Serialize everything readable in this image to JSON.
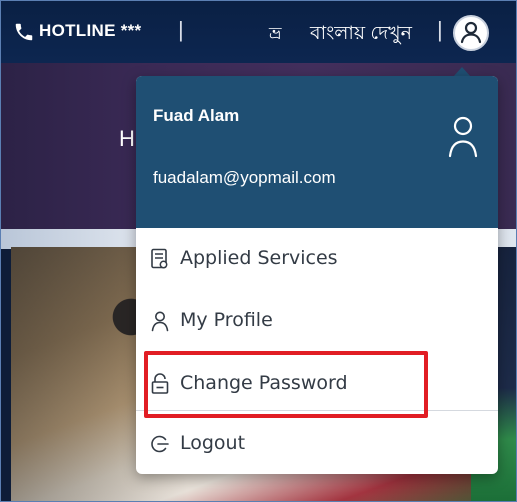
{
  "topbar": {
    "hotline_label": "HOTLINE ***",
    "separator": "|",
    "language_icon_glyph": "ভ্ৰ",
    "language_label": "বাংলায় দেখুন"
  },
  "hero": {
    "heading_partial": "H"
  },
  "dropdown": {
    "user_name": "Fuad Alam",
    "user_email": "fuadalam@yopmail.com",
    "items": [
      {
        "label": "Applied Services",
        "icon": "document-icon"
      },
      {
        "label": "My Profile",
        "icon": "user-icon"
      },
      {
        "label": "Change Password",
        "icon": "lock-icon"
      },
      {
        "label": "Logout",
        "icon": "logout-icon"
      }
    ]
  },
  "colors": {
    "topbar_bg": "#0d2650",
    "dropdown_header_bg": "#1f4f73",
    "highlight_border": "#e11d24",
    "menu_text": "#333b45"
  }
}
